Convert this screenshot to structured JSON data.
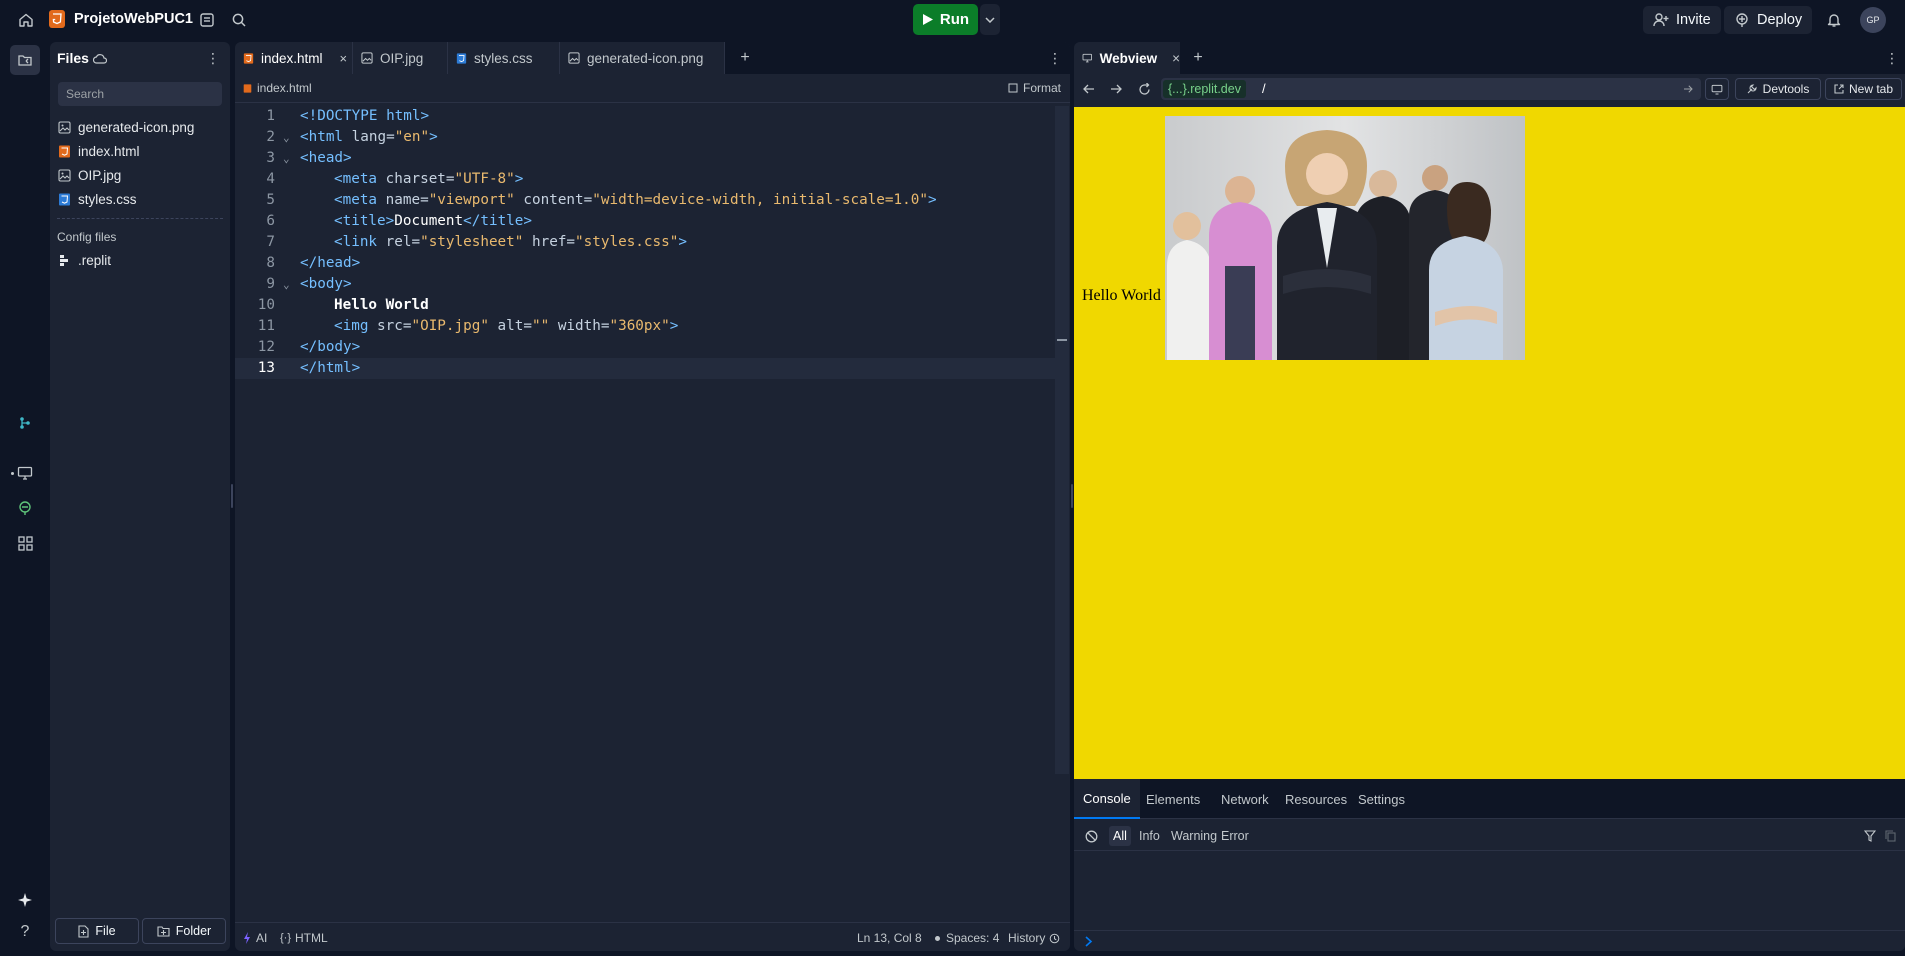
{
  "project": {
    "name": "ProjetoWebPUC1"
  },
  "topbar": {
    "run_label": "Run",
    "invite_label": "Invite",
    "deploy_label": "Deploy",
    "avatar_initials": "GP"
  },
  "files_panel": {
    "title": "Files",
    "search_placeholder": "Search",
    "files": [
      "generated-icon.png",
      "index.html",
      "OIP.jpg",
      "styles.css"
    ],
    "config_heading": "Config files",
    "config_files": [
      ".replit"
    ],
    "new_file_label": "File",
    "new_folder_label": "Folder"
  },
  "editor": {
    "tabs": [
      "index.html",
      "OIP.jpg",
      "styles.css",
      "generated-icon.png"
    ],
    "breadcrumb": "index.html",
    "format_label": "Format",
    "code": {
      "l1_a": "<!DOCTYPE html>",
      "l2_a": "<html",
      "l2_b": " lang=",
      "l2_c": "\"en\"",
      "l2_d": ">",
      "l3_a": "<head>",
      "l4_a": "<meta",
      "l4_b": " charset=",
      "l4_c": "\"UTF-8\"",
      "l4_d": ">",
      "l5_a": "<meta",
      "l5_b": " name=",
      "l5_c": "\"viewport\"",
      "l5_d": " content=",
      "l5_e": "\"width=device-width, initial-scale=1.0\"",
      "l5_f": ">",
      "l6_a": "<title>",
      "l6_b": "Document",
      "l6_c": "</title>",
      "l7_a": "<link",
      "l7_b": " rel=",
      "l7_c": "\"stylesheet\"",
      "l7_d": " href=",
      "l7_e": "\"styles.css\"",
      "l7_f": ">",
      "l8_a": "</head>",
      "l9_a": "<body>",
      "l10_a": "Hello World",
      "l11_a": "<img",
      "l11_b": " src=",
      "l11_c": "\"OIP.jpg\"",
      "l11_d": " alt=",
      "l11_e": "\"\"",
      "l11_f": " width=",
      "l11_g": "\"360px\"",
      "l11_h": ">",
      "l12_a": "</body>",
      "l13_a": "</html>"
    },
    "line_numbers": [
      "1",
      "2",
      "3",
      "4",
      "5",
      "6",
      "7",
      "8",
      "9",
      "10",
      "11",
      "12",
      "13"
    ],
    "status": {
      "ai_label": "AI",
      "language": "HTML",
      "cursor": "Ln 13, Col 8",
      "spaces": "Spaces: 4",
      "history": "History"
    }
  },
  "webview": {
    "tab_label": "Webview",
    "url_host": "{...}.replit.dev",
    "url_path": "/",
    "devtools_label": "Devtools",
    "new_tab_label": "New tab",
    "page_text": "Hello World",
    "page_bg": "#f0d800"
  },
  "console": {
    "tabs": [
      "Console",
      "Elements",
      "Network",
      "Resources",
      "Settings"
    ],
    "filters": [
      "All",
      "Info",
      "Warning",
      "Error"
    ]
  },
  "colors": {
    "accent_run": "#0b7d29",
    "bg": "#0e1525",
    "panel": "#1c2333",
    "link_blue": "#75bfff",
    "string": "#e9b96e",
    "host_green": "#79d28b"
  }
}
